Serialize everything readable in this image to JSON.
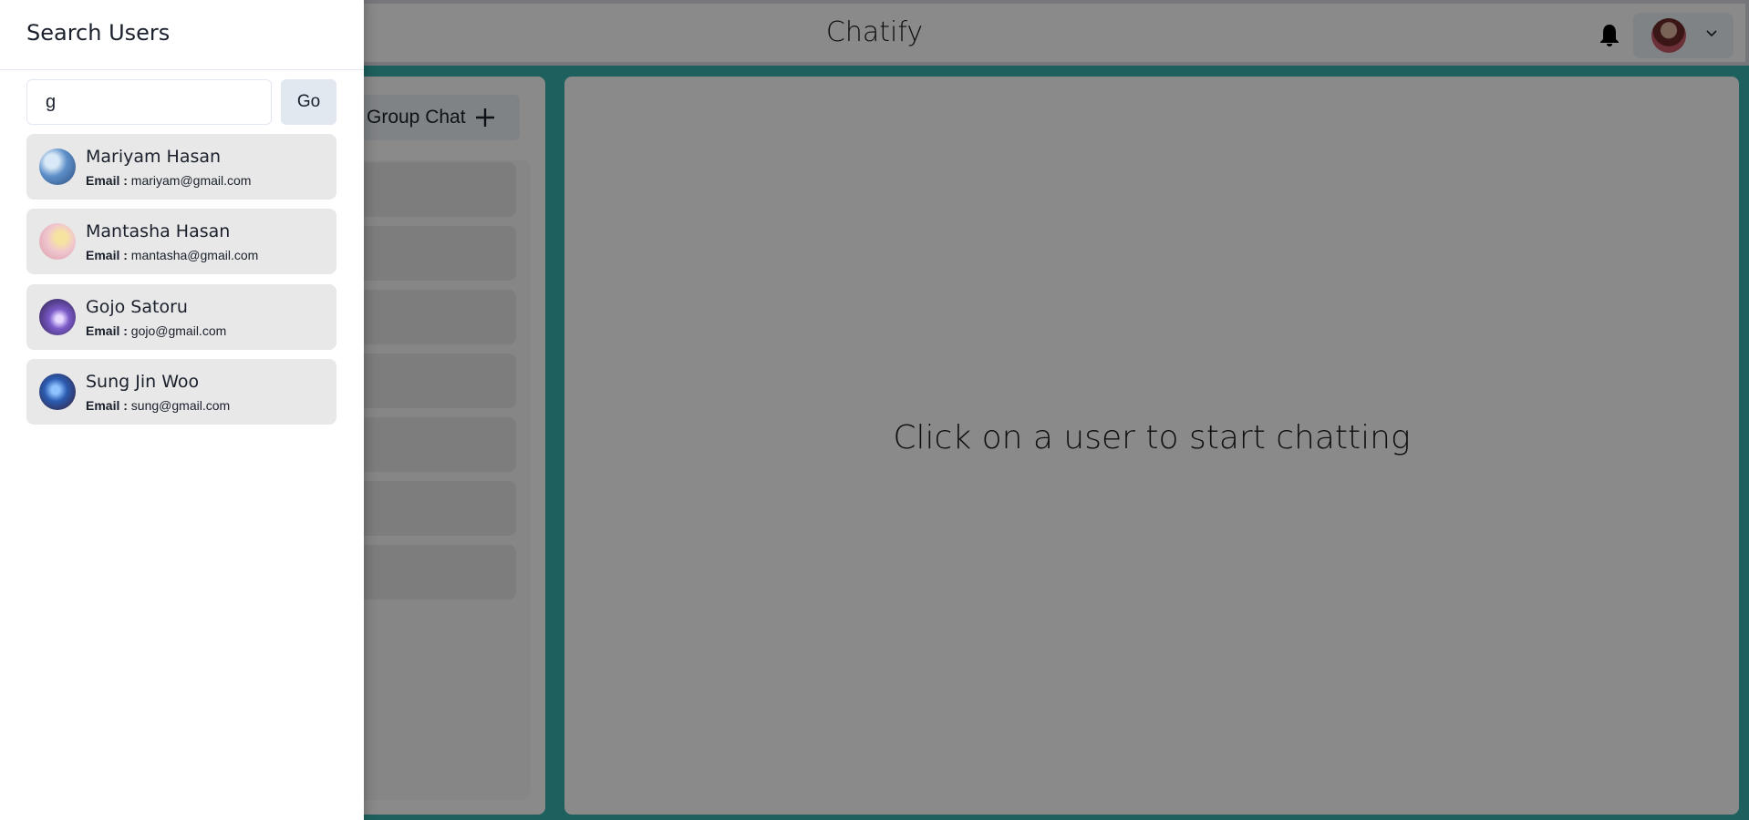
{
  "header": {
    "app_title": "Chatify"
  },
  "sidebar": {
    "group_chat_label": "Group Chat",
    "chat_placeholder_count": 7
  },
  "chat": {
    "empty_message": "Click on a user to start chatting"
  },
  "drawer": {
    "title": "Search Users",
    "search": {
      "value": "g",
      "placeholder": ""
    },
    "go_label": "Go",
    "email_label": "Email :",
    "results": [
      {
        "name": "Mariyam Hasan",
        "email": "mariyam@gmail.com",
        "avatar_color": "#5d8fc9"
      },
      {
        "name": "Mantasha Hasan",
        "email": "mantasha@gmail.com",
        "avatar_color": "#f0c7cf"
      },
      {
        "name": "Gojo Satoru",
        "email": "gojo@gmail.com",
        "avatar_color": "#3b2a63"
      },
      {
        "name": "Sung Jin Woo",
        "email": "sung@gmail.com",
        "avatar_color": "#1f3c78"
      }
    ]
  },
  "colors": {
    "accent": "#38b2ac",
    "overlay": "rgba(0,0,0,0.46)"
  },
  "icons": [
    "bell-icon",
    "chevron-down-icon",
    "plus-icon"
  ]
}
